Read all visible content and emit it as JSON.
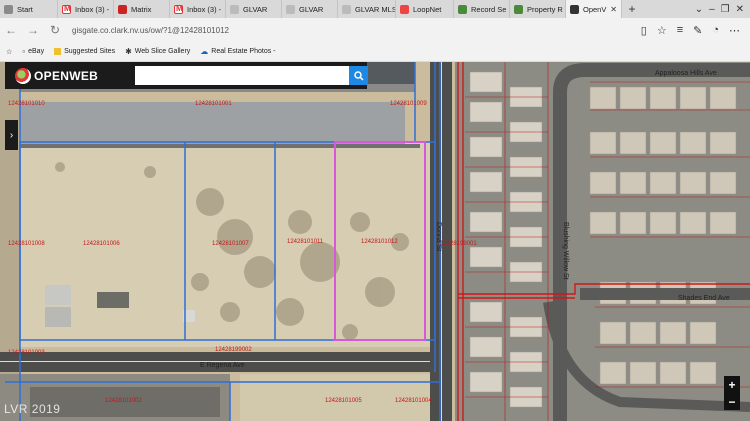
{
  "browser": {
    "tabs": [
      {
        "label": "Start",
        "icon": "start-icon"
      },
      {
        "label": "Inbox (3) -",
        "icon": "gmail-icon"
      },
      {
        "label": "Matrix",
        "icon": "matrix-icon"
      },
      {
        "label": "Inbox (3) -",
        "icon": "gmail-icon"
      },
      {
        "label": "GLVAR",
        "icon": "pin-icon"
      },
      {
        "label": "GLVAR",
        "icon": "pin-icon"
      },
      {
        "label": "GLVAR MLS",
        "icon": "pin-icon"
      },
      {
        "label": "LoopNet",
        "icon": "loopnet-icon"
      },
      {
        "label": "Record Se",
        "icon": "record-icon"
      },
      {
        "label": "Property R",
        "icon": "record-icon"
      },
      {
        "label": "OpenV",
        "icon": "openweb-icon"
      }
    ],
    "url": "gisgate.co.clark.nv.us/ow/?1@12428101012",
    "favorites": [
      {
        "label": "eBay"
      },
      {
        "label": "Suggested Sites"
      },
      {
        "label": "Web Slice Gallery"
      },
      {
        "label": "Real Estate Photos -"
      }
    ]
  },
  "openweb": {
    "logo_text": "OPENWEB",
    "search_placeholder": ""
  },
  "map": {
    "streets": {
      "appaloosa": "Appaloosa Hills Ave",
      "shades": "Shades End Ave",
      "willow": "Blushing Willow St",
      "donna": "Donna St",
      "regena": "E Regena Ave"
    },
    "parcels": {
      "p1": "12428101010",
      "p2": "12428101001",
      "p3": "12428101009",
      "p4": "12428101008",
      "p5": "12428101011",
      "p6": "12428101012",
      "p7": "12428101003",
      "p8": "12428199002",
      "p9": "12428199001",
      "p10": "12428101002",
      "p11": "12428101006",
      "p12": "12428101007",
      "p13": "12428101005",
      "p14": "12428101004"
    },
    "watermark": "LVR 2019"
  }
}
